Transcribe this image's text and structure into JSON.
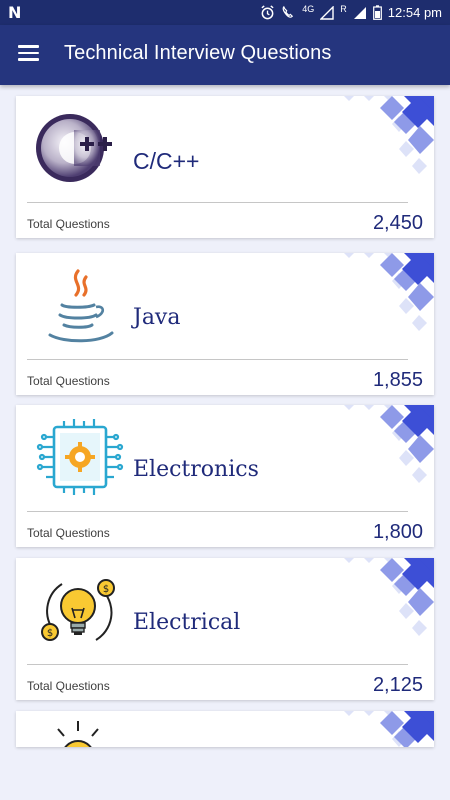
{
  "status_bar": {
    "carrier_icon": "n-notification-icon",
    "network_label": "4G",
    "roaming_label": "R",
    "time": "12:54 pm"
  },
  "app_bar": {
    "menu_icon": "hamburger-menu-icon",
    "title": "Technical Interview Questions"
  },
  "cards": [
    {
      "subject": "C/C++",
      "count_label": "Total Questions",
      "count": "2,450",
      "icon": "cpp-logo-icon"
    },
    {
      "subject": "Java",
      "count_label": "Total Questions",
      "count": "1,855",
      "icon": "java-logo-icon"
    },
    {
      "subject": "Electronics",
      "count_label": "Total Questions",
      "count": "1,800",
      "icon": "circuit-chip-icon"
    },
    {
      "subject": "Electrical",
      "count_label": "Total Questions",
      "count": "2,125",
      "icon": "lightbulb-coins-icon"
    },
    {
      "subject": "",
      "count_label": "",
      "count": "",
      "icon": "sun-bulb-icon"
    }
  ],
  "colors": {
    "status_bar": "#1e2d6e",
    "app_bar": "#25357e",
    "accent": "#1f2a7a",
    "corner_light": "#dfe3f8",
    "corner_dark": "#3b4fd8",
    "background": "#eef0fa"
  }
}
